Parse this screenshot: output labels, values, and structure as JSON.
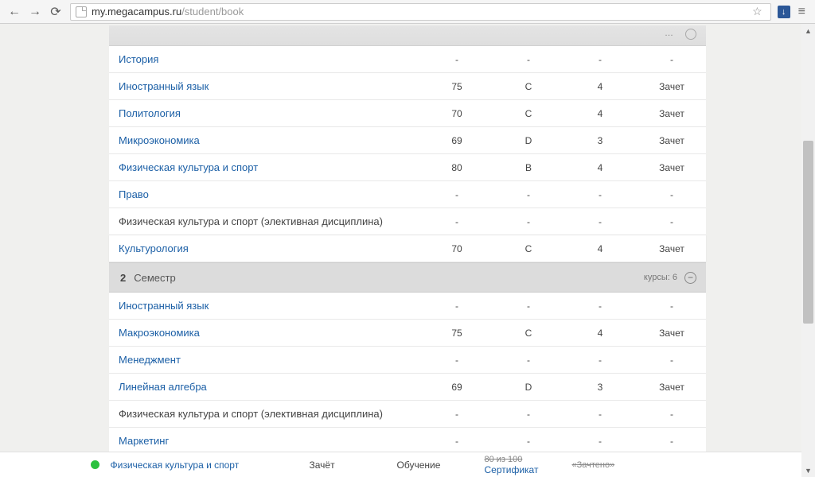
{
  "browser": {
    "url_host": "my.megacampus.ru",
    "url_path": "/student/book"
  },
  "header_strip": {
    "pager_text": "…"
  },
  "semester1_rows": [
    {
      "subject": "История",
      "link": true,
      "score": "-",
      "grade": "-",
      "credits": "-",
      "result": "-"
    },
    {
      "subject": "Иностранный язык",
      "link": true,
      "score": "75",
      "grade": "C",
      "credits": "4",
      "result": "Зачет"
    },
    {
      "subject": "Политология",
      "link": true,
      "score": "70",
      "grade": "C",
      "credits": "4",
      "result": "Зачет"
    },
    {
      "subject": "Микроэкономика",
      "link": true,
      "score": "69",
      "grade": "D",
      "credits": "3",
      "result": "Зачет"
    },
    {
      "subject": "Физическая культура и спорт",
      "link": true,
      "score": "80",
      "grade": "B",
      "credits": "4",
      "result": "Зачет"
    },
    {
      "subject": "Право",
      "link": true,
      "score": "-",
      "grade": "-",
      "credits": "-",
      "result": "-"
    },
    {
      "subject": "Физическая культура и спорт (элективная дисциплина)",
      "link": false,
      "score": "-",
      "grade": "-",
      "credits": "-",
      "result": "-"
    },
    {
      "subject": "Культурология",
      "link": true,
      "score": "70",
      "grade": "C",
      "credits": "4",
      "result": "Зачет",
      "highlighted": true
    }
  ],
  "semester2": {
    "num": "2",
    "label": "Семестр",
    "courses_label": "курсы: 6",
    "toggle": "−"
  },
  "semester2_rows": [
    {
      "subject": "Иностранный язык",
      "link": true,
      "score": "-",
      "grade": "-",
      "credits": "-",
      "result": "-"
    },
    {
      "subject": "Макроэкономика",
      "link": true,
      "score": "75",
      "grade": "C",
      "credits": "4",
      "result": "Зачет"
    },
    {
      "subject": "Менеджмент",
      "link": true,
      "score": "-",
      "grade": "-",
      "credits": "-",
      "result": "-"
    },
    {
      "subject": "Линейная алгебра",
      "link": true,
      "score": "69",
      "grade": "D",
      "credits": "3",
      "result": "Зачет"
    },
    {
      "subject": "Физическая культура и спорт (элективная дисциплина)",
      "link": false,
      "score": "-",
      "grade": "-",
      "credits": "-",
      "result": "-"
    },
    {
      "subject": "Маркетинг",
      "link": true,
      "score": "-",
      "grade": "-",
      "credits": "-",
      "result": "-"
    }
  ],
  "bottom": {
    "subject": "Физическая культура и спорт",
    "col1": "Зачёт",
    "col2": "Обучение",
    "col3_strike": "80 из 100",
    "col3_link": "Сертификат",
    "col4_strike": "«Зачтено»"
  }
}
